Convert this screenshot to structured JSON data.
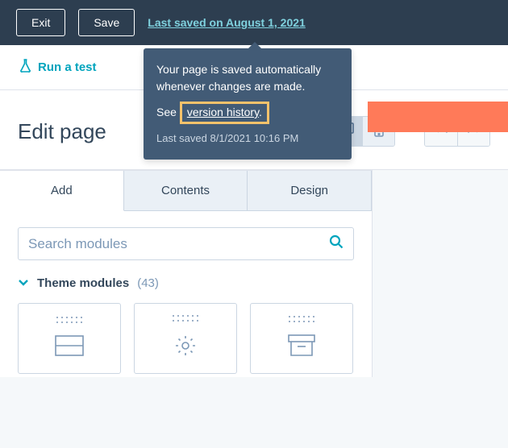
{
  "topbar": {
    "exit": "Exit",
    "save": "Save",
    "saved_link": "Last saved on August 1, 2021"
  },
  "tooltip": {
    "line1": "Your page is saved automatically whenever changes are made.",
    "see": "See",
    "version_history": "version history",
    "period": ".",
    "last_saved": "Last saved 8/1/2021 10:16 PM"
  },
  "runtest": "Run a test",
  "page_title": "Edit page",
  "tabs": {
    "add": "Add",
    "contents": "Contents",
    "design": "Design"
  },
  "search": {
    "placeholder": "Search modules"
  },
  "section": {
    "title": "Theme modules",
    "count": "(43)"
  }
}
